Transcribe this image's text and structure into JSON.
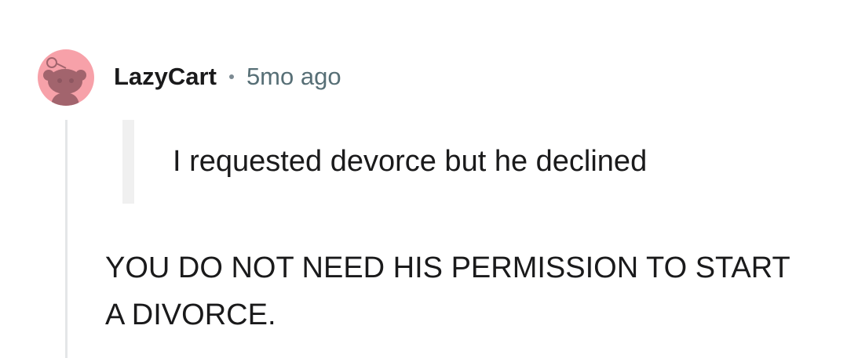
{
  "comment": {
    "author": "LazyCart",
    "timestamp": "5mo ago",
    "quote": "I requested devorce but he declined",
    "body_lines": [
      "YOU DO NOT NEED HIS PERMISSION TO START",
      "A DIVORCE."
    ]
  },
  "avatar": {
    "icon": "reddit-snoo-avatar",
    "background_color": "#f7a1a9",
    "figure_color": "#a2646d"
  },
  "colors": {
    "text": "#1a1a1b",
    "meta": "#576f76",
    "thread_line": "#e4e6e8",
    "quote_bar": "#f0f0f0"
  }
}
